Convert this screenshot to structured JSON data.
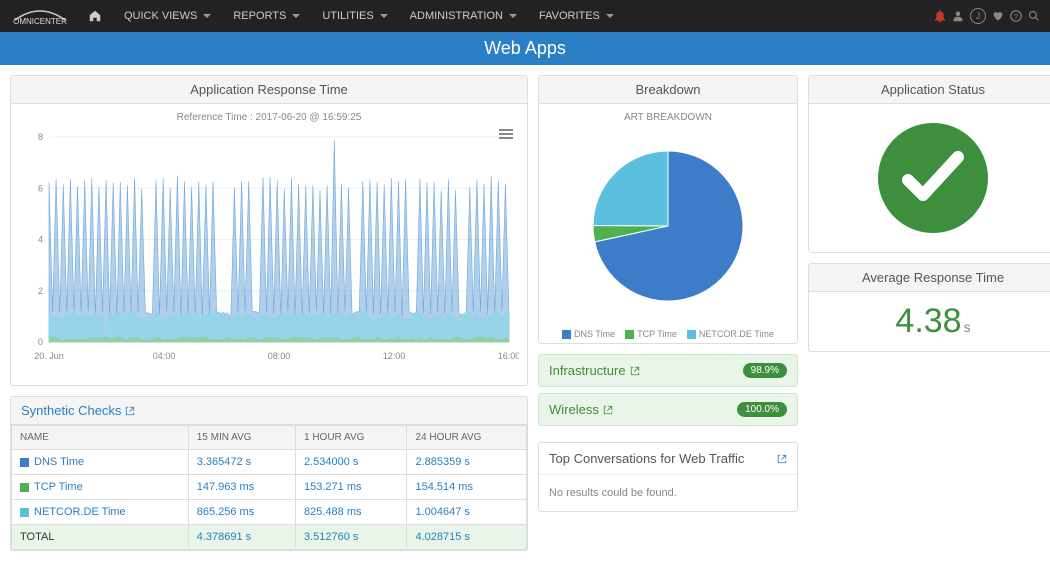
{
  "nav": {
    "brand": "OMNICENTER",
    "items": [
      "QUICK VIEWS",
      "REPORTS",
      "UTILITIES",
      "ADMINISTRATION",
      "FAVORITES"
    ],
    "user_initial": "J"
  },
  "page_title": "Web Apps",
  "art_panel": {
    "title": "Application Response Time",
    "reference": "Reference Time : 2017-06-20 @ 16:59:25",
    "x_labels": [
      "20. Jun",
      "04:00",
      "08:00",
      "12:00",
      "16:00"
    ],
    "y_labels": [
      "0",
      "2",
      "4",
      "6",
      "8"
    ]
  },
  "breakdown": {
    "title": "Breakdown",
    "chart_title": "ART BREAKDOWN",
    "legend": [
      {
        "name": "DNS Time",
        "color": "#3d7cc9"
      },
      {
        "name": "TCP Time",
        "color": "#4fb04f"
      },
      {
        "name": "NETCOR.DE Time",
        "color": "#5bc0de"
      }
    ]
  },
  "status": {
    "title": "Application Status",
    "color": "#3d8f3d"
  },
  "avg_resp": {
    "title": "Average Response Time",
    "value": "4.38",
    "unit": "s"
  },
  "synth": {
    "title": "Synthetic Checks",
    "cols": [
      "NAME",
      "15 MIN AVG",
      "1 HOUR AVG",
      "24 HOUR AVG"
    ],
    "rows": [
      {
        "name": "DNS Time",
        "color": "#3d7cc9",
        "c15": "3.365472 s",
        "c1h": "2.534000 s",
        "c24": "2.885359 s"
      },
      {
        "name": "TCP Time",
        "color": "#4fb04f",
        "c15": "147.963 ms",
        "c1h": "153.271 ms",
        "c24": "154.514 ms"
      },
      {
        "name": "NETCOR.DE Time",
        "color": "#5bc0de",
        "c15": "865.256 ms",
        "c1h": "825.488 ms",
        "c24": "1.004647 s"
      }
    ],
    "total": {
      "name": "TOTAL",
      "c15": "4.378691 s",
      "c1h": "3.512760 s",
      "c24": "4.028715 s"
    }
  },
  "side_rows": [
    {
      "label": "Infrastructure",
      "badge": "98.9%"
    },
    {
      "label": "Wireless",
      "badge": "100.0%"
    }
  ],
  "top_conv": {
    "title": "Top Conversations for Web Traffic",
    "empty": "No results could be found."
  },
  "chart_data": [
    {
      "type": "line",
      "title": "Application Response Time",
      "xlabel": "",
      "ylabel": "",
      "ylim": [
        0,
        8
      ],
      "x_ticks": [
        "20. Jun",
        "04:00",
        "08:00",
        "12:00",
        "16:00"
      ],
      "note": "Spiky time-series; blue series oscillates roughly between ~1 and ~6 with a peak near 8 around 12:00; cyan series is a lower baseline around ~1; green series is very low near 0.",
      "series": [
        {
          "name": "DNS Time",
          "color": "#3d7cc9",
          "approx_range": [
            1,
            6.4
          ],
          "peak": 8
        },
        {
          "name": "TCP Time",
          "color": "#4fb04f",
          "approx_range": [
            0,
            0.3
          ]
        },
        {
          "name": "NETCOR.DE Time",
          "color": "#5bc0de",
          "approx_range": [
            0.7,
            1.3
          ]
        }
      ]
    },
    {
      "type": "pie",
      "title": "ART BREAKDOWN",
      "series": [
        {
          "name": "DNS Time",
          "value": 71.6,
          "color": "#3d7cc9"
        },
        {
          "name": "TCP Time",
          "value": 3.5,
          "color": "#4fb04f"
        },
        {
          "name": "NETCOR.DE Time",
          "value": 24.9,
          "color": "#5bc0de"
        }
      ]
    }
  ]
}
